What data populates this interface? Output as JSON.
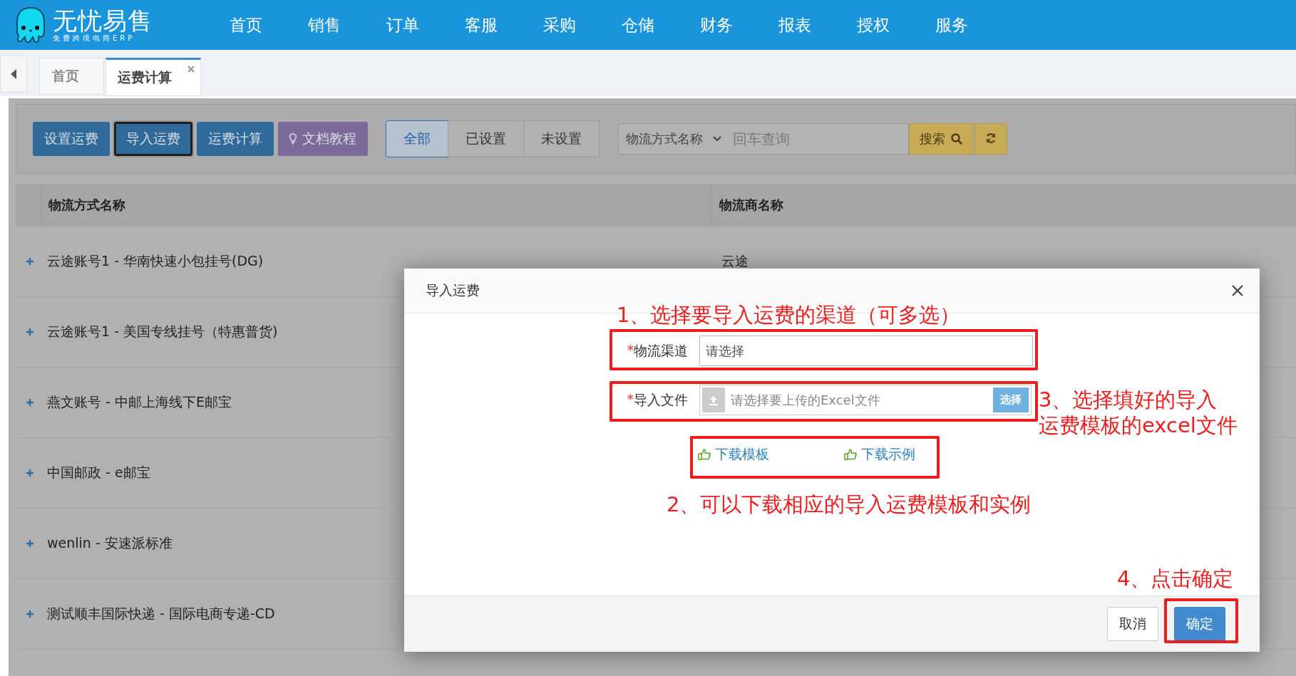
{
  "app": {
    "logo_title": "无忧易售",
    "logo_subtitle": "免费跨境电商ERP"
  },
  "nav": [
    "首页",
    "销售",
    "订单",
    "客服",
    "采购",
    "仓储",
    "财务",
    "报表",
    "授权",
    "服务"
  ],
  "tabs": [
    {
      "label": "首页",
      "selected": false,
      "closable": false
    },
    {
      "label": "运费计算",
      "selected": true,
      "closable": true
    }
  ],
  "toolbar": {
    "buttons": [
      {
        "label": "设置运费",
        "kind": "primary",
        "focused": false
      },
      {
        "label": "导入运费",
        "kind": "primary",
        "focused": true
      },
      {
        "label": "运费计算",
        "kind": "primary",
        "focused": false
      },
      {
        "label": "文档教程",
        "kind": "tutorial",
        "focused": false
      }
    ],
    "filters": [
      {
        "label": "全部",
        "selected": true
      },
      {
        "label": "已设置",
        "selected": false
      },
      {
        "label": "未设置",
        "selected": false
      }
    ],
    "search": {
      "field_select": "物流方式名称",
      "placeholder": "回车查询",
      "button": "搜索"
    }
  },
  "table": {
    "columns": [
      "物流方式名称",
      "物流商名称"
    ],
    "rows": [
      {
        "name": "云途账号1 - 华南快速小包挂号(DG)",
        "carrier": "云途"
      },
      {
        "name": "云途账号1 - 美国专线挂号（特惠普货)"
      },
      {
        "name": "燕文账号 - 中邮上海线下E邮宝"
      },
      {
        "name": "中国邮政 - e邮宝"
      },
      {
        "name": "wenlin - 安速派标准"
      },
      {
        "name": "测试顺丰国际快递 - 国际电商专递-CD"
      }
    ]
  },
  "dialog": {
    "title": "导入运费",
    "fields": [
      {
        "label": "物流渠道",
        "required_mark": "*",
        "kind": "select",
        "placeholder": "请选择"
      },
      {
        "label": "导入文件",
        "required_mark": "*",
        "kind": "file",
        "placeholder": "请选择要上传的Excel文件",
        "button": "选择"
      }
    ],
    "links": [
      "下载模板",
      "下载示例"
    ],
    "buttons": [
      {
        "label": "取消",
        "kind": "default"
      },
      {
        "label": "确定",
        "kind": "primary"
      }
    ]
  },
  "annotations": [
    {
      "lines": [
        "1、选择要导入运费的渠道（可多选）"
      ]
    },
    {
      "lines": [
        "2、可以下载相应的导入运费模板和实例"
      ]
    },
    {
      "lines": [
        "3、选择填好的导入",
        "运费模板的excel文件"
      ]
    },
    {
      "lines": [
        "4、点击确定"
      ]
    }
  ]
}
